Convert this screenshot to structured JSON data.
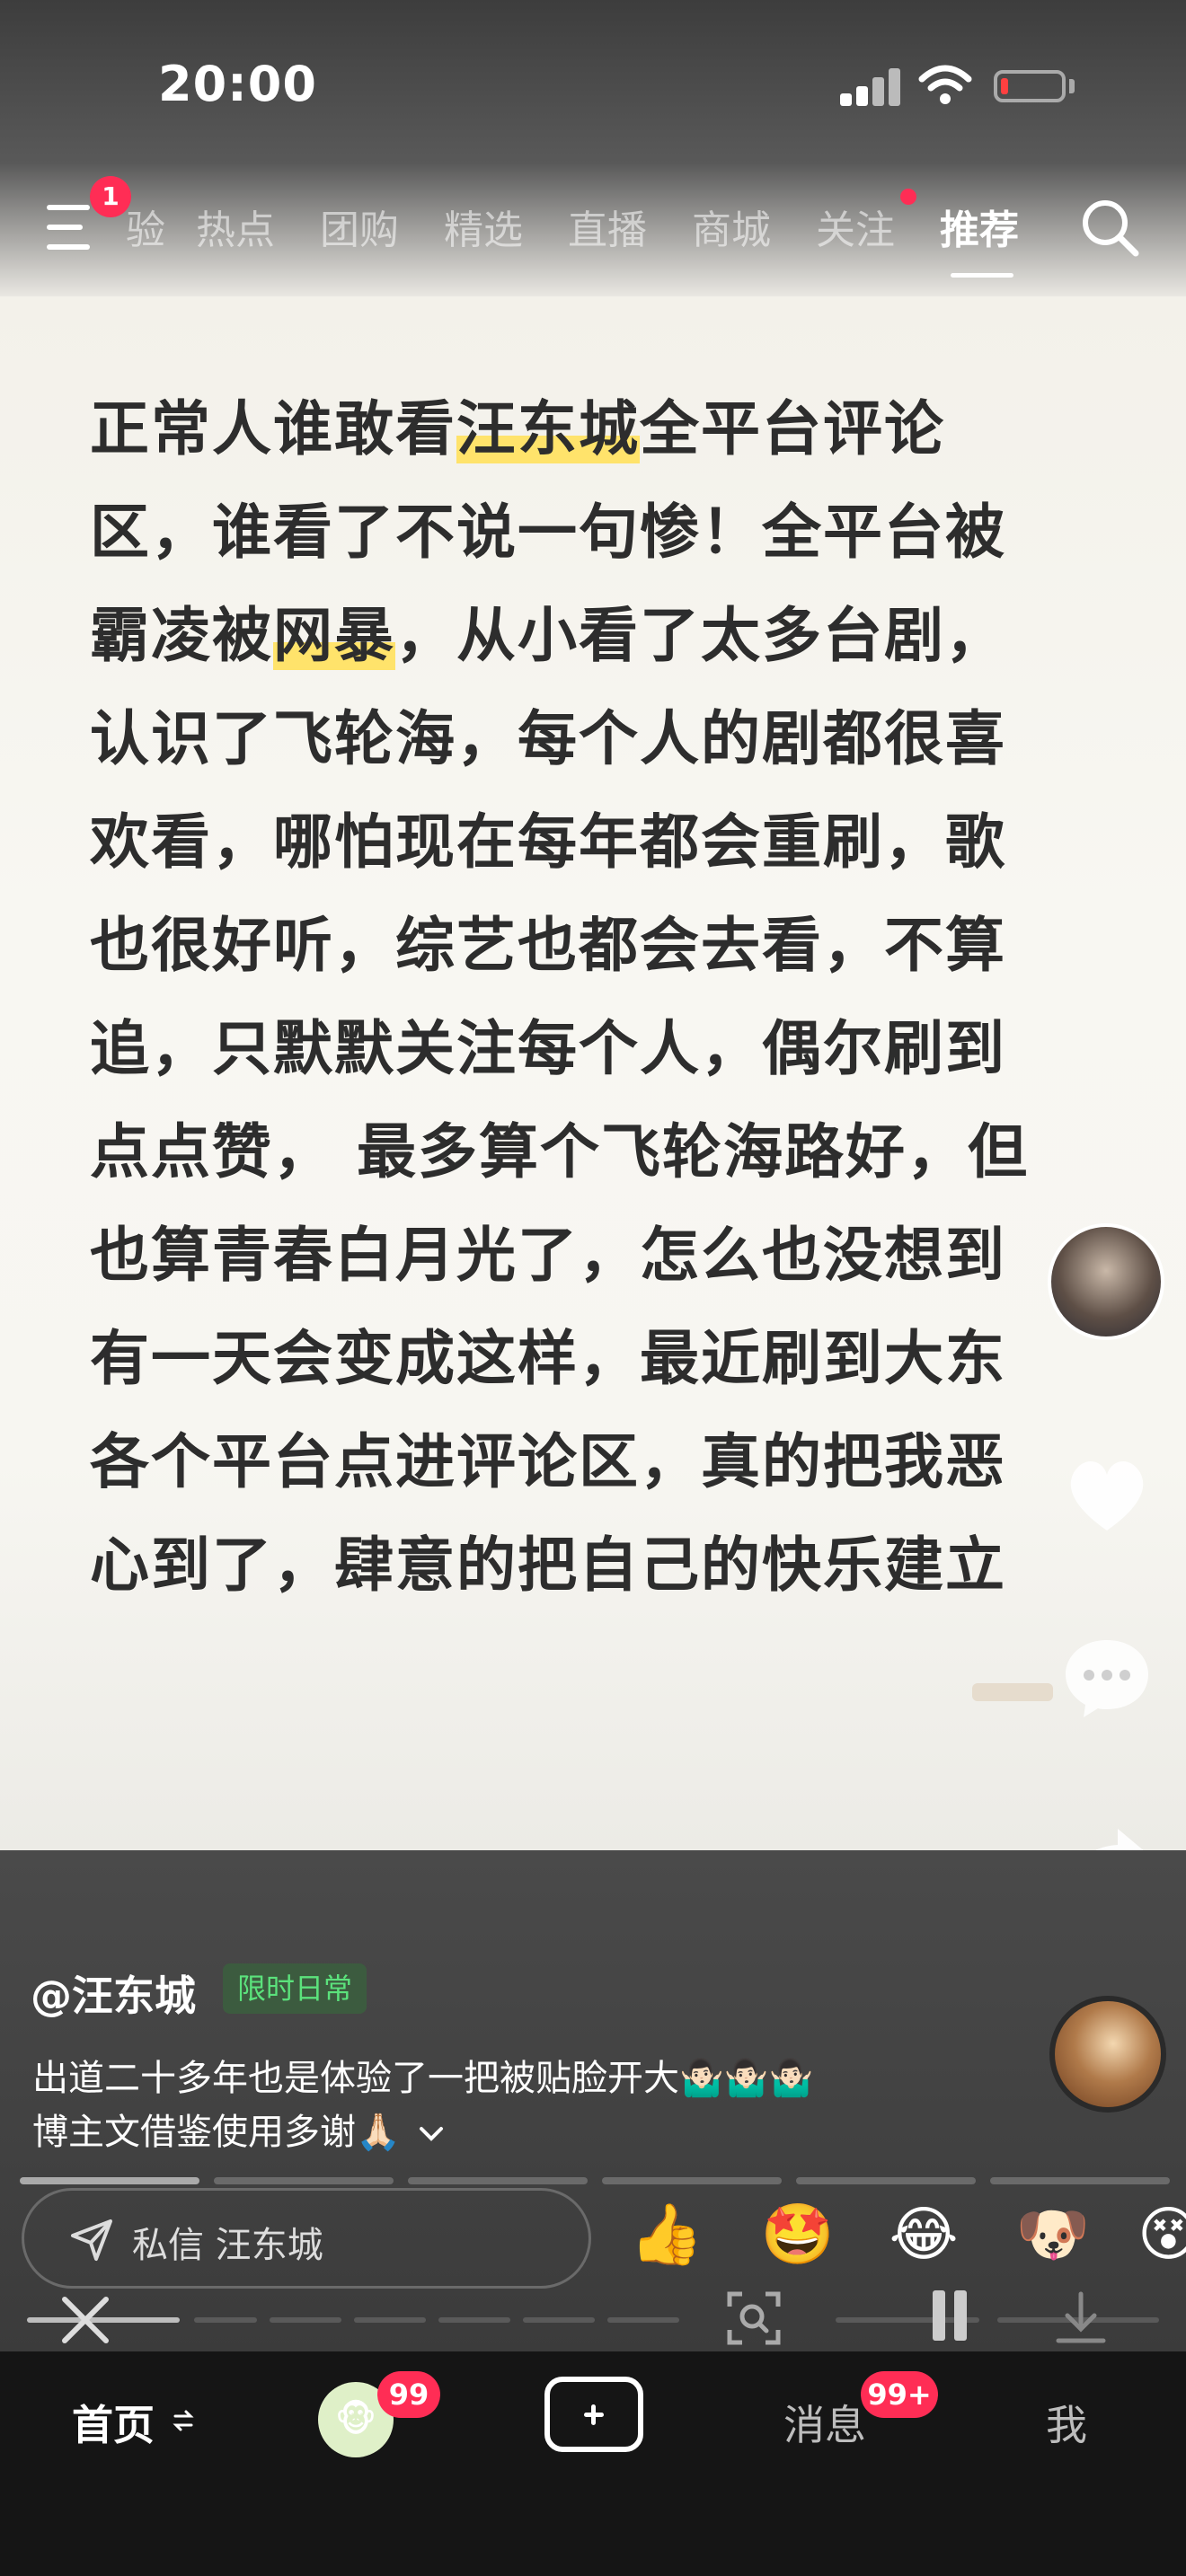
{
  "status": {
    "time": "20:00"
  },
  "top_nav": {
    "menu_badge": "1",
    "tabs": [
      "验",
      "热点",
      "团购",
      "精选",
      "直播",
      "商城",
      "关注",
      "推荐"
    ],
    "active_tab": "推荐"
  },
  "post": {
    "lines": [
      [
        "正常人谁敢看",
        "汪东城",
        "全平台评论"
      ],
      [
        "区，谁看了不说一句惨！全平台被"
      ],
      [
        "霸凌被",
        "网暴",
        "，从小看了太多台剧，"
      ],
      [
        "认识了飞轮海，每个人的剧都很喜"
      ],
      [
        "欢看，哪怕现在每年都会重刷，歌"
      ],
      [
        "也很好听，综艺也都会去看，不算"
      ],
      [
        "追，只默默关注每个人，偶尔刷到"
      ],
      [
        "点点赞， 最多算个飞轮海路好，但"
      ],
      [
        "也算青春白月光了，怎么也没想到"
      ],
      [
        "有一天会变成这样，最近刷到大东"
      ],
      [
        "各个平台点进评论区，真的把我恶"
      ],
      [
        "心到了，肆意的把自己的快乐建立"
      ]
    ]
  },
  "info": {
    "author": "@汪东城",
    "tag": "限时日常",
    "desc_line1": "出道二十多年也是体验了一把被贴脸开大🤷🏻‍♂️🤷🏻‍♂️🤷🏻‍♂️",
    "desc_line2": "博主文借鉴使用多谢🙏🏻",
    "expand_icon": "chevron-down-icon"
  },
  "dm": {
    "placeholder": "私信 汪东城"
  },
  "emojis": [
    "👍",
    "🤩",
    "😂",
    "🐶",
    "😵"
  ],
  "tabbar": {
    "home": "首页",
    "friends_badge": "99",
    "messages": "消息",
    "messages_badge": "99+",
    "me": "我"
  },
  "colors": {
    "accent_red": "#ff2d55",
    "highlight_yellow": "#ffe36b",
    "tag_green": "#5be27c"
  }
}
